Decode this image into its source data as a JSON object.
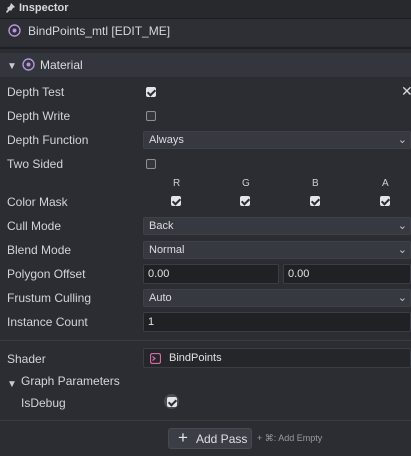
{
  "panel": {
    "title": "Inspector"
  },
  "asset": {
    "name": "BindPoints_mtl [EDIT_ME]"
  },
  "material": {
    "section_label": "Material",
    "depth_test": {
      "label": "Depth Test",
      "checked": true
    },
    "depth_write": {
      "label": "Depth Write",
      "checked": false
    },
    "depth_function": {
      "label": "Depth Function",
      "value": "Always"
    },
    "two_sided": {
      "label": "Two Sided",
      "checked": false
    },
    "color_mask": {
      "label": "Color Mask",
      "channels": [
        {
          "name": "R",
          "checked": true
        },
        {
          "name": "G",
          "checked": true
        },
        {
          "name": "B",
          "checked": true
        },
        {
          "name": "A",
          "checked": true
        }
      ]
    },
    "cull_mode": {
      "label": "Cull Mode",
      "value": "Back"
    },
    "blend_mode": {
      "label": "Blend Mode",
      "value": "Normal"
    },
    "polygon_offset": {
      "label": "Polygon Offset",
      "value1": "0.00",
      "value2": "0.00"
    },
    "frustum_culling": {
      "label": "Frustum Culling",
      "value": "Auto"
    },
    "instance_count": {
      "label": "Instance Count",
      "value": "1"
    }
  },
  "shader": {
    "label": "Shader",
    "value": "BindPoints"
  },
  "graph_parameters": {
    "label": "Graph Parameters",
    "is_debug": {
      "label": "IsDebug",
      "checked": true
    }
  },
  "footer": {
    "add_pass_label": "Add Pass",
    "hint": "+ ⌘: Add Empty"
  },
  "colors": {
    "background": "#2b2d32",
    "checkbox_checked": "#e4e5e8",
    "shader_icon": "#d46aa7"
  }
}
